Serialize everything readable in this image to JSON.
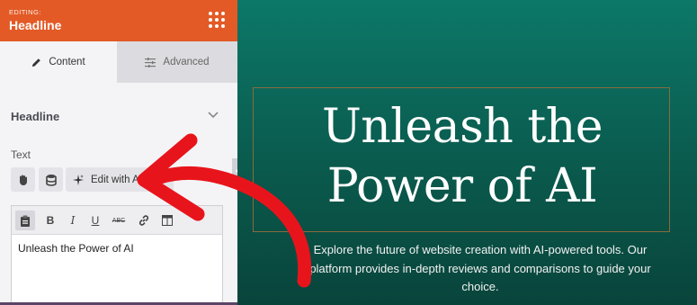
{
  "panel": {
    "editing_label": "EDITING:",
    "title": "Headline",
    "accent_color": "#e35a26"
  },
  "tabs": [
    {
      "label": "Content",
      "icon": "pencil-icon",
      "active": true
    },
    {
      "label": "Advanced",
      "icon": "sliders-icon",
      "active": false
    }
  ],
  "section": {
    "title": "Headline"
  },
  "text_field": {
    "label": "Text",
    "ai_button_label": "Edit with AI",
    "value": "Unleash the Power of AI"
  },
  "toolbar": {
    "bold": "B",
    "italic": "I",
    "underline": "U",
    "strike": "ABC"
  },
  "preview": {
    "headline_line1": "Unleash the",
    "headline_line2": "Power of AI",
    "subtext": "Explore the future of website creation with AI-powered tools. Our platform provides in-depth reviews and comparisons to guide your choice.",
    "background_color": "#0a5a4d",
    "annotation_color": "#e8141c"
  }
}
